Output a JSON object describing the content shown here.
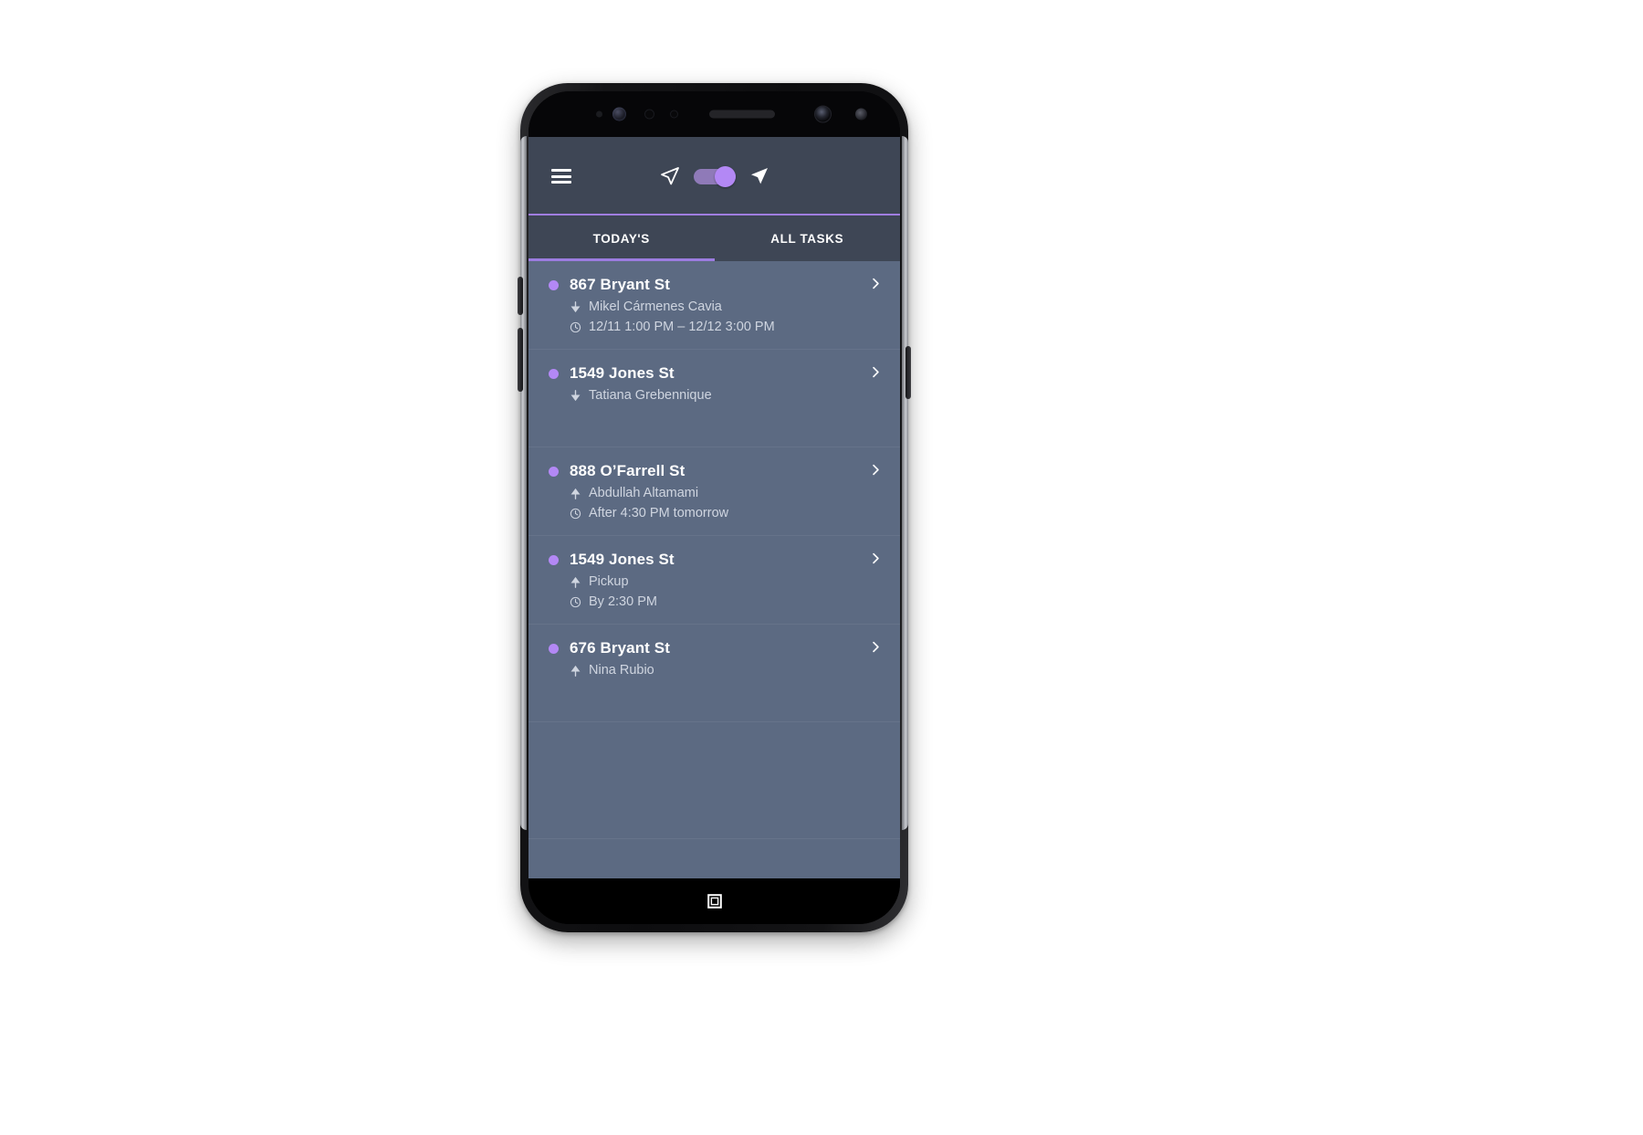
{
  "device": {
    "name": "android-phone",
    "hardware": [
      "proximity-sensor",
      "iris-scanner",
      "sensor-ring",
      "sensor-ring-small",
      "earpiece-speaker",
      "front-camera",
      "flash-sensor"
    ],
    "nav_button": "recents-square-button"
  },
  "appbar": {
    "menu_label": "menu",
    "left_arrow_icon": "navigation-arrow-outline-icon",
    "right_arrow_icon": "navigation-arrow-filled-icon",
    "toggle_state": "on",
    "accent_color": "#a07ee0"
  },
  "tabs": {
    "items": [
      {
        "label": "TODAY'S",
        "active": true
      },
      {
        "label": "ALL TASKS",
        "active": false
      }
    ],
    "indicator_color": "#9c7ce0"
  },
  "colors": {
    "appbar_bg": "#3e4655",
    "list_bg": "#5c6a82",
    "dot": "#b388f5",
    "title": "#ffffff",
    "subtext": "#cfd5e0",
    "divider": "#66738a"
  },
  "tasks": [
    {
      "address": "867 Bryant St",
      "dir_icon": "arrow-down-icon",
      "dir_type": "dropoff",
      "contact": "Mikel Cármenes Cavia",
      "time_icon": "clock-icon",
      "time": "12/11 1:00 PM – 12/12 3:00 PM",
      "chevron": "chevron-right-icon"
    },
    {
      "address": "1549 Jones St",
      "dir_icon": "arrow-down-icon",
      "dir_type": "dropoff",
      "contact": "Tatiana Grebennique",
      "time_icon": "",
      "time": "",
      "chevron": "chevron-right-icon"
    },
    {
      "address": "888 O’Farrell St",
      "dir_icon": "arrow-up-icon",
      "dir_type": "pickup",
      "contact": "Abdullah Altamami",
      "time_icon": "clock-icon",
      "time": "After 4:30 PM tomorrow",
      "chevron": "chevron-right-icon"
    },
    {
      "address": "1549 Jones St",
      "dir_icon": "arrow-up-icon",
      "dir_type": "pickup",
      "contact": "Pickup",
      "time_icon": "clock-icon",
      "time": "By 2:30 PM",
      "chevron": "chevron-right-icon"
    },
    {
      "address": "676 Bryant St",
      "dir_icon": "arrow-up-icon",
      "dir_type": "pickup",
      "contact": "Nina Rubio",
      "time_icon": "",
      "time": "",
      "chevron": "chevron-right-icon"
    }
  ]
}
